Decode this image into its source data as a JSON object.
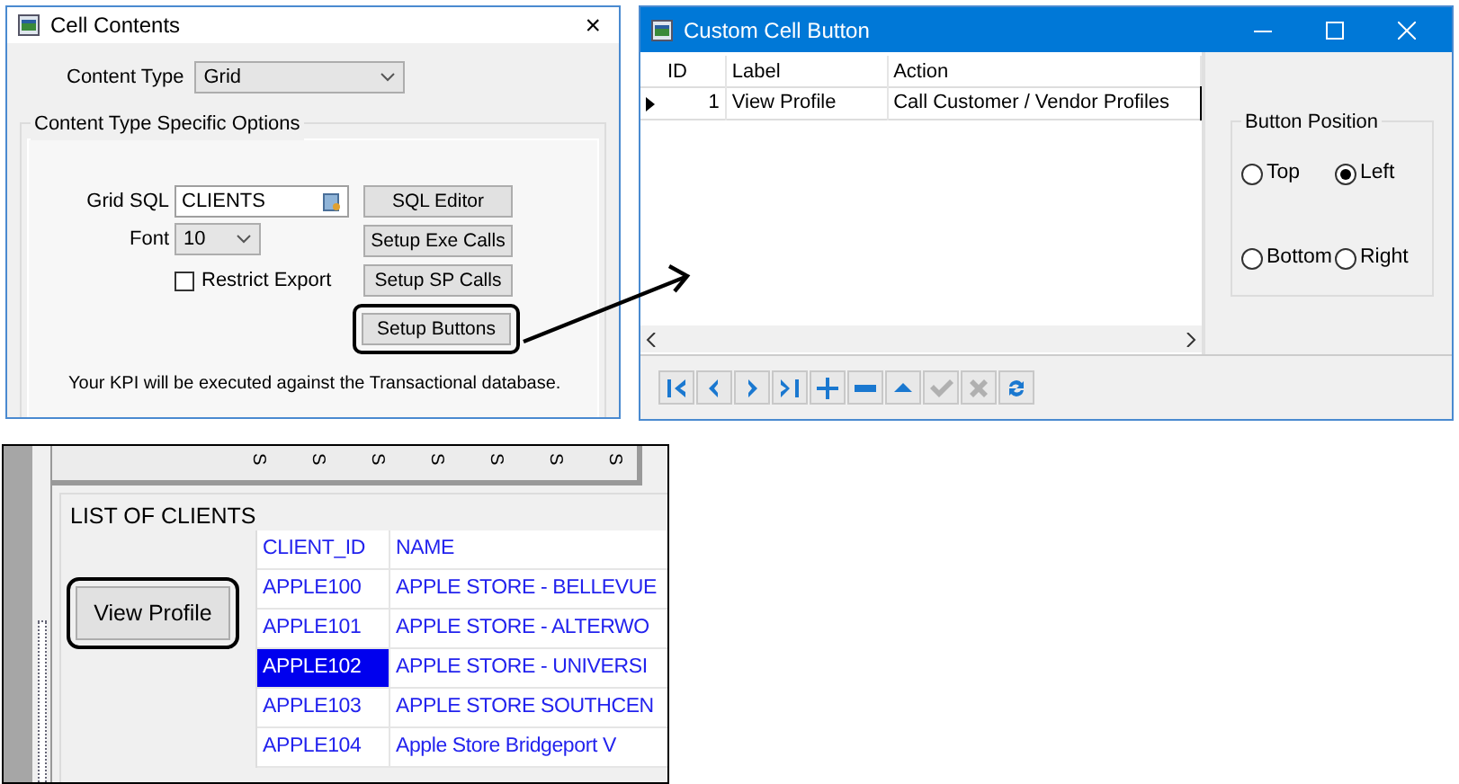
{
  "cell_contents_window": {
    "title": "Cell Contents",
    "close": "×",
    "content_type": {
      "label": "Content Type",
      "value": "Grid"
    },
    "group_title": "Content Type Specific Options",
    "grid_sql": {
      "label": "Grid SQL",
      "value": "CLIENTS"
    },
    "font": {
      "label": "Font",
      "value": "10"
    },
    "restrict_export": {
      "label": "Restrict Export",
      "checked": false
    },
    "buttons": [
      {
        "label": "SQL Editor",
        "highlighted": false
      },
      {
        "label": "Setup Exe Calls",
        "highlighted": false
      },
      {
        "label": "Setup SP Calls",
        "highlighted": false
      },
      {
        "label": "Setup Buttons",
        "highlighted": true
      }
    ],
    "note": "Your KPI will be executed against the Transactional database."
  },
  "custom_cell_button_window": {
    "title": "Custom Cell Button",
    "columns": [
      "ID",
      "Label",
      "Action"
    ],
    "rows": [
      {
        "id": "1",
        "label": "View Profile",
        "action": "Call Customer / Vendor Profiles",
        "current": true
      }
    ],
    "button_position": {
      "title": "Button Position",
      "options": [
        {
          "label": "Top",
          "selected": false
        },
        {
          "label": "Left",
          "selected": true
        },
        {
          "label": "Bottom",
          "selected": false
        },
        {
          "label": "Right",
          "selected": false
        }
      ]
    },
    "toolbar": [
      {
        "kind": "first",
        "disabled": false
      },
      {
        "kind": "previous",
        "disabled": false
      },
      {
        "kind": "next",
        "disabled": false
      },
      {
        "kind": "last",
        "disabled": false
      },
      {
        "kind": "add",
        "disabled": false
      },
      {
        "kind": "remove",
        "disabled": false
      },
      {
        "kind": "up",
        "disabled": false
      },
      {
        "kind": "save",
        "disabled": true
      },
      {
        "kind": "cancel",
        "disabled": true
      },
      {
        "kind": "refresh",
        "disabled": false
      }
    ]
  },
  "preview": {
    "ruler_marks": [
      "S",
      "S",
      "S",
      "S",
      "S",
      "S",
      "S"
    ],
    "group_title": "LIST OF CLIENTS",
    "button": {
      "label": "View Profile",
      "highlighted": true
    },
    "columns": [
      "CLIENT_ID",
      "NAME"
    ],
    "rows": [
      {
        "client_id": "APPLE100",
        "name": "APPLE STORE - BELLEVUE",
        "selected": false
      },
      {
        "client_id": "APPLE101",
        "name": "APPLE STORE - ALTERWO",
        "selected": false
      },
      {
        "client_id": "APPLE102",
        "name": "APPLE STORE - UNIVERSI",
        "selected": true
      },
      {
        "client_id": "APPLE103",
        "name": "APPLE STORE SOUTHCEN",
        "selected": false
      },
      {
        "client_id": "APPLE104",
        "name": "Apple Store Bridgeport V",
        "selected": false
      }
    ]
  }
}
